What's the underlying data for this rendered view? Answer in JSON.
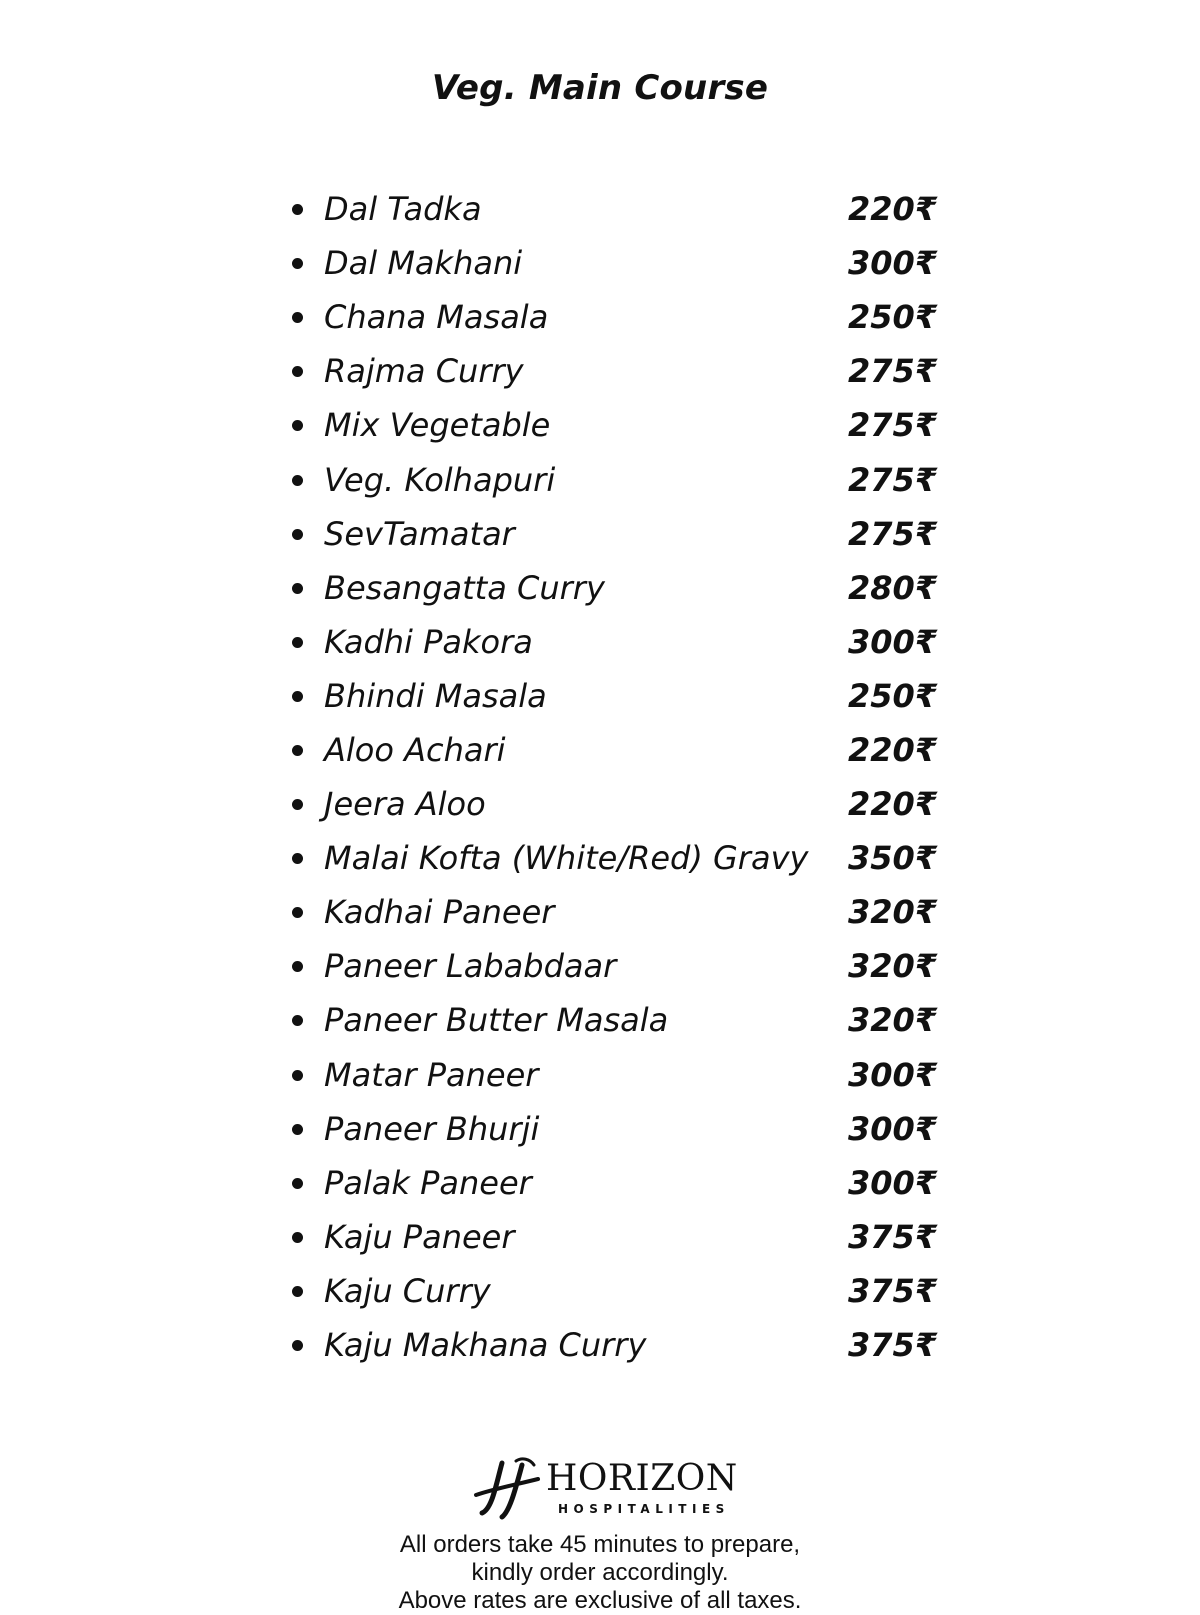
{
  "title": "Veg. Main Course",
  "items": [
    {
      "name": "Dal Tadka",
      "price": "220₹"
    },
    {
      "name": "Dal Makhani",
      "price": "300₹"
    },
    {
      "name": "Chana Masala",
      "price": "250₹"
    },
    {
      "name": "Rajma Curry",
      "price": "275₹"
    },
    {
      "name": "Mix Vegetable",
      "price": "275₹"
    },
    {
      "name": "Veg. Kolhapuri",
      "price": "275₹"
    },
    {
      "name": "SevTamatar",
      "price": "275₹"
    },
    {
      "name": "Besangatta Curry",
      "price": "280₹"
    },
    {
      "name": "Kadhi Pakora",
      "price": "300₹"
    },
    {
      "name": "Bhindi Masala",
      "price": "250₹"
    },
    {
      "name": "Aloo Achari",
      "price": "220₹"
    },
    {
      "name": "Jeera Aloo",
      "price": "220₹"
    },
    {
      "name": "Malai Kofta (White/Red) Gravy",
      "price": "350₹"
    },
    {
      "name": "Kadhai Paneer",
      "price": "320₹"
    },
    {
      "name": "Paneer Lababdaar",
      "price": "320₹"
    },
    {
      "name": "Paneer Butter Masala",
      "price": "320₹"
    },
    {
      "name": "Matar Paneer",
      "price": "300₹"
    },
    {
      "name": "Paneer Bhurji",
      "price": "300₹"
    },
    {
      "name": "Palak Paneer",
      "price": "300₹"
    },
    {
      "name": "Kaju Paneer",
      "price": "375₹"
    },
    {
      "name": "Kaju Curry",
      "price": "375₹"
    },
    {
      "name": "Kaju Makhana Curry",
      "price": "375₹"
    }
  ],
  "logo": {
    "name": "HORIZON",
    "subtitle": "HOSPITALITIES",
    "icon": "horizon-logo-mark"
  },
  "notes": [
    "All orders take 45 minutes to prepare,",
    "kindly order accordingly.",
    "Above rates are exclusive of all taxes."
  ]
}
